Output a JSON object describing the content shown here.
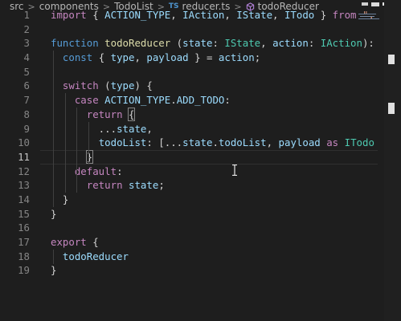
{
  "breadcrumb": {
    "items": [
      "src",
      "components",
      "TodoList",
      "reducer.ts",
      "todoReducer"
    ],
    "ts_badge": "TS"
  },
  "editor": {
    "active_line": 11,
    "lines": [
      {
        "n": "1",
        "tokens": [
          {
            "t": "import",
            "c": "c"
          },
          {
            "t": " { ",
            "c": "p"
          },
          {
            "t": "ACTION_TYPE",
            "c": "v"
          },
          {
            "t": ", ",
            "c": "p"
          },
          {
            "t": "IAction",
            "c": "v"
          },
          {
            "t": ", ",
            "c": "p"
          },
          {
            "t": "IState",
            "c": "v"
          },
          {
            "t": ", ",
            "c": "p"
          },
          {
            "t": "ITodo",
            "c": "v"
          },
          {
            "t": " } ",
            "c": "p"
          },
          {
            "t": "from",
            "c": "c"
          },
          {
            "t": " \"",
            "c": "s"
          },
          {
            "t": ".",
            "c": "s"
          }
        ]
      },
      {
        "n": "2",
        "tokens": []
      },
      {
        "n": "3",
        "tokens": [
          {
            "t": "function",
            "c": "k"
          },
          {
            "t": " ",
            "c": "p"
          },
          {
            "t": "todoReducer",
            "c": "f"
          },
          {
            "t": " (",
            "c": "p"
          },
          {
            "t": "state",
            "c": "v"
          },
          {
            "t": ": ",
            "c": "p"
          },
          {
            "t": "IState",
            "c": "t"
          },
          {
            "t": ", ",
            "c": "p"
          },
          {
            "t": "action",
            "c": "v"
          },
          {
            "t": ": ",
            "c": "p"
          },
          {
            "t": "IAction",
            "c": "t"
          },
          {
            "t": "):",
            "c": "p"
          }
        ]
      },
      {
        "n": "4",
        "tokens": [
          {
            "t": "  ",
            "c": "p"
          },
          {
            "t": "const",
            "c": "k"
          },
          {
            "t": " { ",
            "c": "p"
          },
          {
            "t": "type",
            "c": "v"
          },
          {
            "t": ", ",
            "c": "p"
          },
          {
            "t": "payload",
            "c": "v"
          },
          {
            "t": " } = ",
            "c": "p"
          },
          {
            "t": "action",
            "c": "v"
          },
          {
            "t": ";",
            "c": "p"
          }
        ]
      },
      {
        "n": "5",
        "tokens": []
      },
      {
        "n": "6",
        "tokens": [
          {
            "t": "  ",
            "c": "p"
          },
          {
            "t": "switch",
            "c": "c"
          },
          {
            "t": " (",
            "c": "p"
          },
          {
            "t": "type",
            "c": "v"
          },
          {
            "t": ") {",
            "c": "p"
          }
        ]
      },
      {
        "n": "7",
        "tokens": [
          {
            "t": "    ",
            "c": "p"
          },
          {
            "t": "case",
            "c": "c"
          },
          {
            "t": " ",
            "c": "p"
          },
          {
            "t": "ACTION_TYPE",
            "c": "v"
          },
          {
            "t": ".",
            "c": "p"
          },
          {
            "t": "ADD_TODO",
            "c": "v"
          },
          {
            "t": ":",
            "c": "p"
          }
        ]
      },
      {
        "n": "8",
        "tokens": [
          {
            "t": "      ",
            "c": "p"
          },
          {
            "t": "return",
            "c": "c"
          },
          {
            "t": " ",
            "c": "p"
          },
          {
            "t": "{",
            "c": "p",
            "m": true
          }
        ]
      },
      {
        "n": "9",
        "tokens": [
          {
            "t": "        ...",
            "c": "p"
          },
          {
            "t": "state",
            "c": "v"
          },
          {
            "t": ",",
            "c": "p"
          }
        ]
      },
      {
        "n": "10",
        "tokens": [
          {
            "t": "        ",
            "c": "p"
          },
          {
            "t": "todoList",
            "c": "v"
          },
          {
            "t": ": [...",
            "c": "p"
          },
          {
            "t": "state",
            "c": "v"
          },
          {
            "t": ".",
            "c": "p"
          },
          {
            "t": "todoList",
            "c": "v"
          },
          {
            "t": ", ",
            "c": "p"
          },
          {
            "t": "payload",
            "c": "v"
          },
          {
            "t": " ",
            "c": "p"
          },
          {
            "t": "as",
            "c": "c"
          },
          {
            "t": " ",
            "c": "p"
          },
          {
            "t": "ITodo",
            "c": "t"
          }
        ]
      },
      {
        "n": "11",
        "tokens": [
          {
            "t": "      ",
            "c": "p"
          },
          {
            "t": "}",
            "c": "p",
            "m": true
          }
        ]
      },
      {
        "n": "12",
        "tokens": [
          {
            "t": "    ",
            "c": "p"
          },
          {
            "t": "default",
            "c": "c"
          },
          {
            "t": ":",
            "c": "p"
          }
        ]
      },
      {
        "n": "13",
        "tokens": [
          {
            "t": "      ",
            "c": "p"
          },
          {
            "t": "return",
            "c": "c"
          },
          {
            "t": " ",
            "c": "p"
          },
          {
            "t": "state",
            "c": "v"
          },
          {
            "t": ";",
            "c": "p"
          }
        ]
      },
      {
        "n": "14",
        "tokens": [
          {
            "t": "  }",
            "c": "p"
          }
        ]
      },
      {
        "n": "15",
        "tokens": [
          {
            "t": "}",
            "c": "p"
          }
        ]
      },
      {
        "n": "16",
        "tokens": []
      },
      {
        "n": "17",
        "tokens": [
          {
            "t": "export",
            "c": "c"
          },
          {
            "t": " {",
            "c": "p"
          }
        ]
      },
      {
        "n": "18",
        "tokens": [
          {
            "t": "  ",
            "c": "p"
          },
          {
            "t": "todoReducer",
            "c": "v"
          }
        ]
      },
      {
        "n": "19",
        "tokens": [
          {
            "t": "}",
            "c": "p"
          }
        ]
      }
    ]
  },
  "colors": {
    "background": "#1e1e1e",
    "keyword": "#569cd6",
    "control": "#c586c0",
    "function": "#dcdcaa",
    "variable": "#9cdcfe",
    "type": "#4ec9b0",
    "string": "#ce9178",
    "line_number": "#858585"
  }
}
